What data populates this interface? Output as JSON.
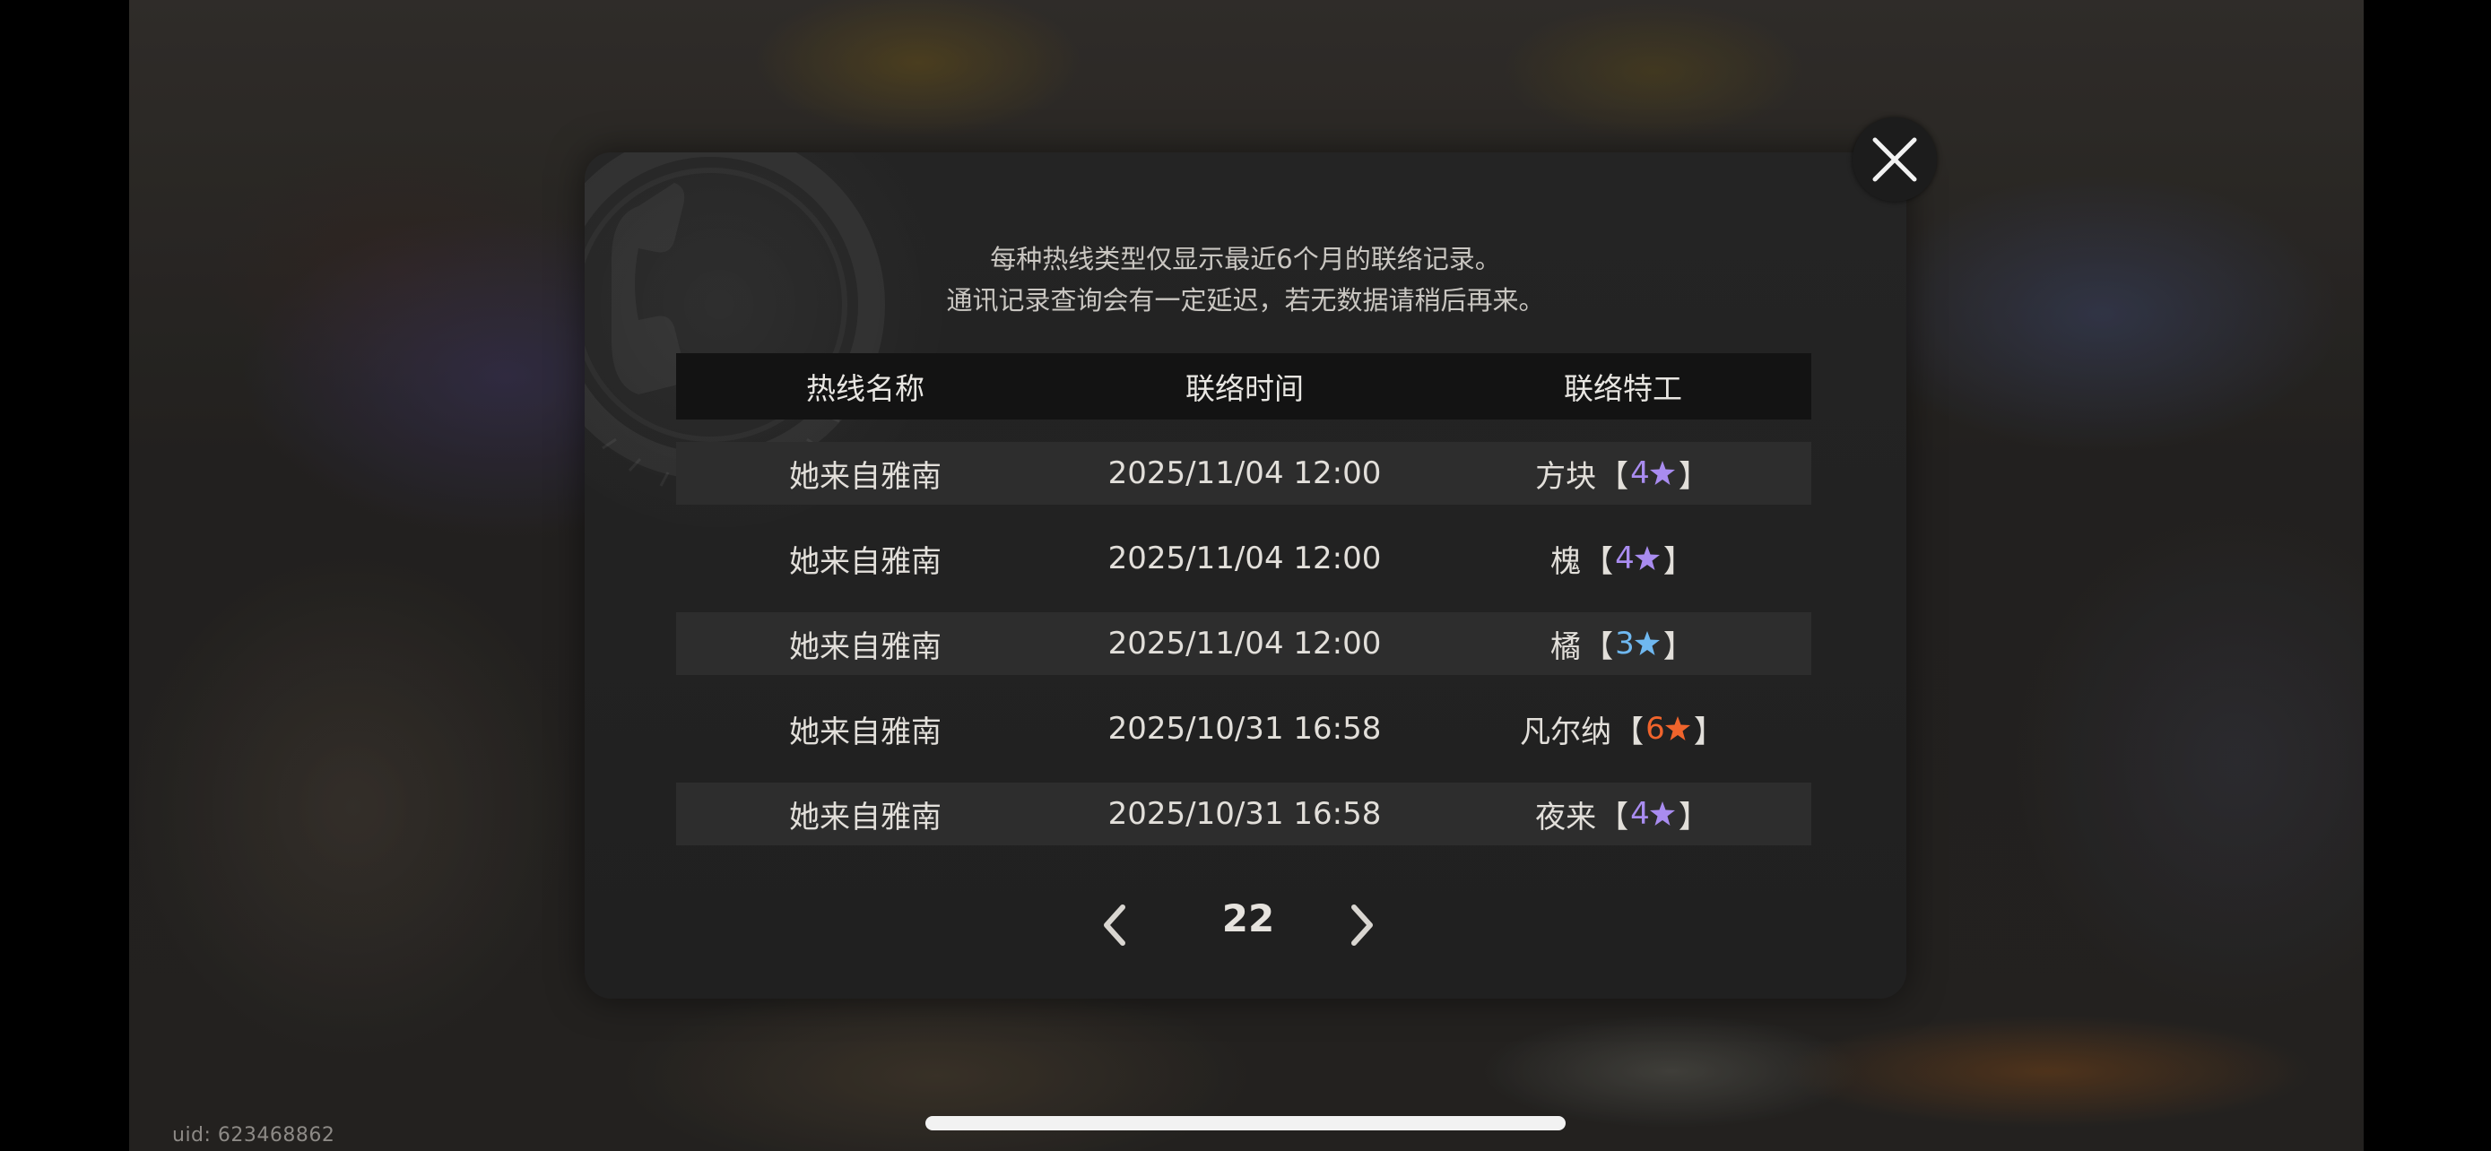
{
  "notice": {
    "line1": "每种热线类型仅显示最近6个月的联络记录。",
    "line2": "通讯记录查询会有一定延迟，若无数据请稍后再来。"
  },
  "table": {
    "headers": [
      "热线名称",
      "联络时间",
      "联络特工"
    ],
    "rows": [
      {
        "hotline": "她来自雅南",
        "time": "2025/11/04 12:00",
        "agent": "方块",
        "rank": "4",
        "rank_color": "#a98cf0"
      },
      {
        "hotline": "她来自雅南",
        "time": "2025/11/04 12:00",
        "agent": "槐",
        "rank": "4",
        "rank_color": "#a98cf0"
      },
      {
        "hotline": "她来自雅南",
        "time": "2025/11/04 12:00",
        "agent": "橘",
        "rank": "3",
        "rank_color": "#6fb8f0"
      },
      {
        "hotline": "她来自雅南",
        "time": "2025/10/31 16:58",
        "agent": "凡尔纳",
        "rank": "6",
        "rank_color": "#f0642c"
      },
      {
        "hotline": "她来自雅南",
        "time": "2025/10/31 16:58",
        "agent": "夜来",
        "rank": "4",
        "rank_color": "#a98cf0"
      }
    ],
    "bracket_open": "【",
    "bracket_close": "】"
  },
  "pager": {
    "page": "22",
    "prev_icon": "chevron-left-icon",
    "next_icon": "chevron-right-icon"
  },
  "close_icon": "close-icon",
  "uid": "uid: 623468862",
  "colors": {
    "panel": "#222222",
    "header_bg": "#131313",
    "row_shade": "#2d2d2d"
  }
}
